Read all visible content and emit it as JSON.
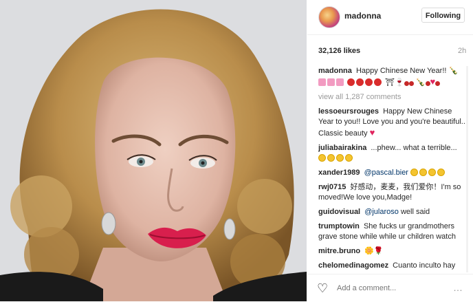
{
  "post": {
    "username": "madonna",
    "follow_label": "Following",
    "likes": "32,126 likes",
    "time": "2h",
    "caption_user": "madonna",
    "caption_text": "Happy Chinese New Year!!",
    "view_all": "view all 1,287 comments",
    "add_comment_placeholder": "Add a comment...",
    "more_label": "…"
  },
  "comments": [
    {
      "user": "lessoeursrouges",
      "text": "Happy New Chinese Year to you!! Love you and you're beautiful.. Classic beauty"
    },
    {
      "user": "juliabairakina",
      "text": "...phew... what a terrible..."
    },
    {
      "user": "xander1989",
      "mention": "@pascal.bier",
      "text": ""
    },
    {
      "user": "rwj0715",
      "text": "好感动，麦麦，我们爱你！I'm so moved!We love you,Madge!"
    },
    {
      "user": "guidovisual",
      "mention": "@jularoso",
      "text": "well said"
    },
    {
      "user": "trumptowin",
      "text": "She fucks ur grandmothers grave stone while while ur children watch"
    },
    {
      "user": "mitre.bruno",
      "text": ""
    },
    {
      "user": "chelomedinagomez",
      "text": "Cuanto inculto hay por la vida"
    }
  ],
  "colors": {
    "heart": "#e0245e",
    "mention": "#003569",
    "muted": "#999999"
  }
}
